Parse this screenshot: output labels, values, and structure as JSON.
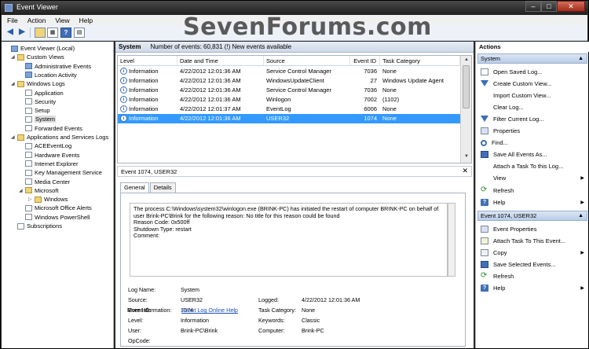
{
  "window": {
    "title": "Event Viewer"
  },
  "watermark": "SevenForums.com",
  "menu": [
    "File",
    "Action",
    "View",
    "Help"
  ],
  "tree": [
    {
      "label": "Event Viewer (Local)",
      "level": 0,
      "exp": "",
      "icon": "custom"
    },
    {
      "label": "Custom Views",
      "level": 1,
      "exp": "◢",
      "icon": "folder"
    },
    {
      "label": "Administrative Events",
      "level": 2,
      "exp": "",
      "icon": "custom"
    },
    {
      "label": "Location Activity",
      "level": 2,
      "exp": "",
      "icon": "custom"
    },
    {
      "label": "Windows Logs",
      "level": 1,
      "exp": "◢",
      "icon": "folder"
    },
    {
      "label": "Application",
      "level": 2,
      "exp": "",
      "icon": "log"
    },
    {
      "label": "Security",
      "level": 2,
      "exp": "",
      "icon": "log"
    },
    {
      "label": "Setup",
      "level": 2,
      "exp": "",
      "icon": "log"
    },
    {
      "label": "System",
      "level": 2,
      "exp": "",
      "icon": "log",
      "selected": true
    },
    {
      "label": "Forwarded Events",
      "level": 2,
      "exp": "",
      "icon": "log"
    },
    {
      "label": "Applications and Services Logs",
      "level": 1,
      "exp": "◢",
      "icon": "folder"
    },
    {
      "label": "ACEEventLog",
      "level": 2,
      "exp": "",
      "icon": "log"
    },
    {
      "label": "Hardware Events",
      "level": 2,
      "exp": "",
      "icon": "log"
    },
    {
      "label": "Internet Explorer",
      "level": 2,
      "exp": "",
      "icon": "log"
    },
    {
      "label": "Key Management Service",
      "level": 2,
      "exp": "",
      "icon": "log"
    },
    {
      "label": "Media Center",
      "level": 2,
      "exp": "",
      "icon": "log"
    },
    {
      "label": "Microsoft",
      "level": 2,
      "exp": "◢",
      "icon": "folder"
    },
    {
      "label": "Windows",
      "level": 3,
      "exp": "▷",
      "icon": "folder"
    },
    {
      "label": "Microsoft Office Alerts",
      "level": 2,
      "exp": "",
      "icon": "log"
    },
    {
      "label": "Windows PowerShell",
      "level": 2,
      "exp": "",
      "icon": "log"
    },
    {
      "label": "Subscriptions",
      "level": 1,
      "exp": "",
      "icon": "log"
    }
  ],
  "header": {
    "name": "System",
    "summary": "Number of events: 60,831 (!) New events available"
  },
  "columns": [
    "Level",
    "Date and Time",
    "Source",
    "Event ID",
    "Task Category"
  ],
  "events": [
    {
      "level": "Information",
      "date": "4/22/2012 12:01:36 AM",
      "source": "Service Control Manager",
      "id": "7036",
      "task": "None"
    },
    {
      "level": "Information",
      "date": "4/22/2012 12:01:36 AM",
      "source": "WindowsUpdateClient",
      "id": "27",
      "task": "Windows Update Agent"
    },
    {
      "level": "Information",
      "date": "4/22/2012 12:01:36 AM",
      "source": "Service Control Manager",
      "id": "7036",
      "task": "None"
    },
    {
      "level": "Information",
      "date": "4/22/2012 12:01:36 AM",
      "source": "Winlogon",
      "id": "7002",
      "task": "(1102)"
    },
    {
      "level": "Information",
      "date": "4/22/2012 12:01:37 AM",
      "source": "EventLog",
      "id": "6006",
      "task": "None"
    },
    {
      "level": "Information",
      "date": "4/22/2012 12:01:36 AM",
      "source": "USER32",
      "id": "1074",
      "task": "None",
      "selected": true
    }
  ],
  "detail": {
    "title": "Event 1074, USER32",
    "tabs": [
      "General",
      "Details"
    ],
    "message": [
      "The process C:\\Windows\\system32\\winlogon.exe (BRINK-PC) has initiated the restart of computer BRINK-PC on behalf of",
      "user Brink-PC\\Brink for the following reason: No title for this reason could be found",
      "Reason Code: 0x500ff",
      "Shutdown Type: restart",
      "Comment:"
    ],
    "fields": {
      "log_name_label": "Log Name:",
      "log_name": "System",
      "source_label": "Source:",
      "source": "USER32",
      "logged_label": "Logged:",
      "logged": "4/22/2012 12:01:36 AM",
      "event_id_label": "Event ID:",
      "event_id": "1074",
      "task_label": "Task Category:",
      "task": "None",
      "level_label": "Level:",
      "level": "Information",
      "keywords_label": "Keywords:",
      "keywords": "Classic",
      "user_label": "User:",
      "user": "Brink-PC\\Brink",
      "computer_label": "Computer:",
      "computer": "Brink-PC",
      "opcode_label": "OpCode:",
      "opcode": "",
      "more_label": "More Information:",
      "more_link": "Event Log Online Help"
    }
  },
  "actions": {
    "header": "Actions",
    "section1": "System",
    "items1": [
      {
        "label": "Open Saved Log...",
        "icon": "doc"
      },
      {
        "label": "Create Custom View...",
        "icon": "funnel"
      },
      {
        "label": "Import Custom View...",
        "icon": "none"
      },
      {
        "label": "Clear Log...",
        "icon": "none"
      },
      {
        "label": "Filter Current Log...",
        "icon": "funnel"
      },
      {
        "label": "Properties",
        "icon": "props"
      },
      {
        "label": "Find...",
        "icon": "find"
      },
      {
        "label": "Save All Events As...",
        "icon": "save"
      },
      {
        "label": "Attach a Task To this Log...",
        "icon": "none"
      },
      {
        "label": "View",
        "icon": "none",
        "sub": true
      },
      {
        "label": "Refresh",
        "icon": "refresh"
      },
      {
        "label": "Help",
        "icon": "help",
        "sub": true
      }
    ],
    "section2": "Event 1074, USER32",
    "items2": [
      {
        "label": "Event Properties",
        "icon": "props"
      },
      {
        "label": "Attach Task To This Event...",
        "icon": "task"
      },
      {
        "label": "Copy",
        "icon": "copy",
        "sub": true
      },
      {
        "label": "Save Selected Events...",
        "icon": "save"
      },
      {
        "label": "Refresh",
        "icon": "refresh"
      },
      {
        "label": "Help",
        "icon": "help",
        "sub": true
      }
    ]
  }
}
